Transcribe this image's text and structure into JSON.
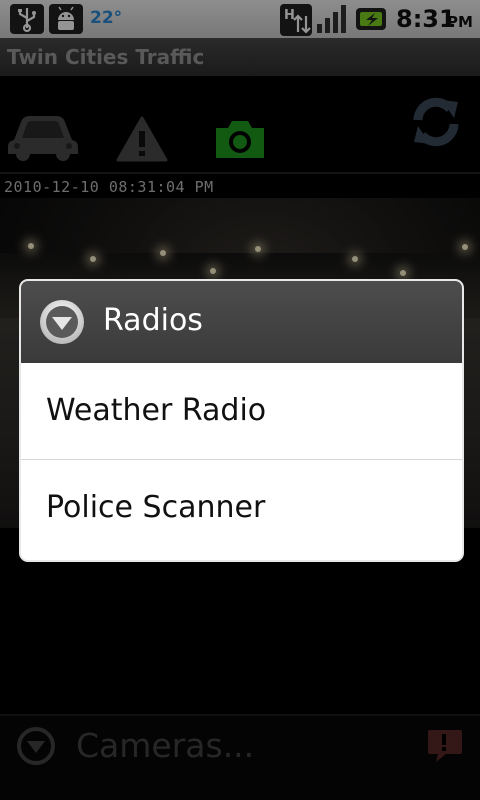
{
  "status_bar": {
    "temperature": "22°",
    "time": "8:31",
    "ampm": "PM"
  },
  "app": {
    "title": "Twin Cities Traffic"
  },
  "toolbar": {
    "items": [
      "car-icon",
      "warning-icon",
      "camera-icon",
      "refresh-icon"
    ],
    "active_color": "#1f9a1f"
  },
  "camera": {
    "timestamp": "2010-12-10 08:31:04 PM"
  },
  "dialog": {
    "title": "Radios",
    "options": [
      {
        "label": "Weather Radio"
      },
      {
        "label": "Police Scanner"
      }
    ]
  },
  "bottom_bar": {
    "selector_label": "Cameras..."
  }
}
